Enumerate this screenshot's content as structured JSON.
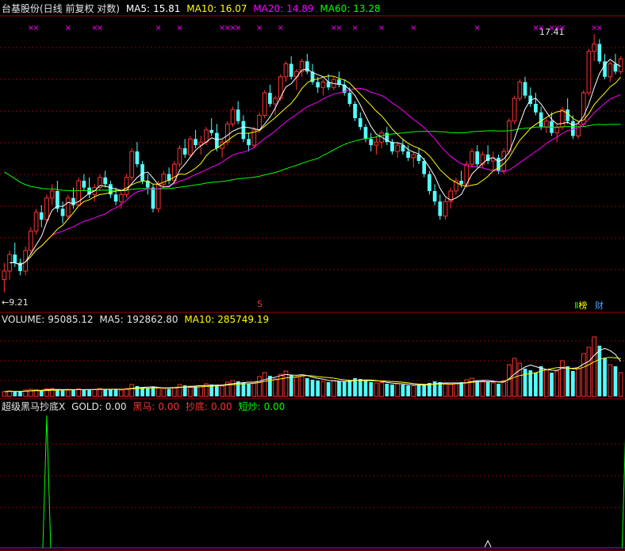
{
  "header": {
    "title": "台基股份(日线 前复权 对数)",
    "ma5_label": "MA5:",
    "ma5": "15.81",
    "ma10_label": "MA10:",
    "ma10": "16.07",
    "ma20_label": "MA20:",
    "ma20": "14.89",
    "ma60_label": "MA60:",
    "ma60": "13.28"
  },
  "volume_header": {
    "label": "VOLUME:",
    "value": "95085.12",
    "ma5_label": "MA5:",
    "ma5": "192862.80",
    "ma10_label": "MA10:",
    "ma10": "285749.19"
  },
  "indicator_header": {
    "name": "超级黑马抄底X",
    "gold_label": "GOLD:",
    "gold": "0.00",
    "heima_label": "黑马:",
    "heima": "0.00",
    "chaodi_label": "抄底:",
    "chaodi": "0.00",
    "duanchao_label": "短炒:",
    "duanchao": "0.00"
  },
  "annotations": {
    "high_label": "17.41",
    "low_label": "9.21",
    "marker_s": "S",
    "btn_bang": "榜",
    "btn_cai": "财",
    "btn_bang_prefix": "Ⅱ"
  },
  "colors": {
    "up": "#ff3232",
    "down": "#54ffff",
    "ma5": "#ffffff",
    "ma10": "#ffff00",
    "ma20": "#ff00ff",
    "ma60": "#00ff00",
    "grid": "#8b0000",
    "mark": "#ff00ff"
  },
  "chart_data": {
    "type": "candlestick",
    "price_range": [
      8.9,
      18.2
    ],
    "candles": [
      [
        9.6,
        10.0,
        9.3,
        9.8
      ],
      [
        9.8,
        10.3,
        9.6,
        10.2
      ],
      [
        10.2,
        10.5,
        9.9,
        10.0
      ],
      [
        10.0,
        10.1,
        9.7,
        9.8
      ],
      [
        9.8,
        10.4,
        9.7,
        10.3
      ],
      [
        10.3,
        10.9,
        10.2,
        10.8
      ],
      [
        10.8,
        11.4,
        10.7,
        11.3
      ],
      [
        11.3,
        11.5,
        10.9,
        11.1
      ],
      [
        11.1,
        11.8,
        11.0,
        11.7
      ],
      [
        11.7,
        12.1,
        11.5,
        11.9
      ],
      [
        11.9,
        12.2,
        11.3,
        11.4
      ],
      [
        11.4,
        11.6,
        11.0,
        11.2
      ],
      [
        11.2,
        11.8,
        11.1,
        11.7
      ],
      [
        11.7,
        12.0,
        11.4,
        11.5
      ],
      [
        11.5,
        12.3,
        11.5,
        12.2
      ],
      [
        12.2,
        12.4,
        11.9,
        12.0
      ],
      [
        12.0,
        12.3,
        11.7,
        11.8
      ],
      [
        11.8,
        12.1,
        11.6,
        12.0
      ],
      [
        12.0,
        12.4,
        11.9,
        12.3
      ],
      [
        12.3,
        12.5,
        12.0,
        12.1
      ],
      [
        12.1,
        12.2,
        11.7,
        11.8
      ],
      [
        11.8,
        12.0,
        11.5,
        11.6
      ],
      [
        11.6,
        11.9,
        11.4,
        11.8
      ],
      [
        11.8,
        12.4,
        11.7,
        12.3
      ],
      [
        12.3,
        13.2,
        12.2,
        13.1
      ],
      [
        13.1,
        13.4,
        12.6,
        12.7
      ],
      [
        12.7,
        12.8,
        12.1,
        12.2
      ],
      [
        12.2,
        12.4,
        11.8,
        12.0
      ],
      [
        12.0,
        12.1,
        11.3,
        11.4
      ],
      [
        11.4,
        12.2,
        11.3,
        12.1
      ],
      [
        12.1,
        12.5,
        12.0,
        12.4
      ],
      [
        12.4,
        12.6,
        12.1,
        12.2
      ],
      [
        12.2,
        12.8,
        12.1,
        12.7
      ],
      [
        12.7,
        13.3,
        12.6,
        13.2
      ],
      [
        13.2,
        13.5,
        12.9,
        13.0
      ],
      [
        13.0,
        13.6,
        12.9,
        13.5
      ],
      [
        13.5,
        13.8,
        13.2,
        13.3
      ],
      [
        13.3,
        13.6,
        13.0,
        13.4
      ],
      [
        13.4,
        13.9,
        13.3,
        13.8
      ],
      [
        13.8,
        14.2,
        13.6,
        13.7
      ],
      [
        13.7,
        14.0,
        13.1,
        13.2
      ],
      [
        13.2,
        13.5,
        12.9,
        13.4
      ],
      [
        13.4,
        14.1,
        13.3,
        14.0
      ],
      [
        14.0,
        14.6,
        13.9,
        14.5
      ],
      [
        14.5,
        14.8,
        14.0,
        14.1
      ],
      [
        14.1,
        14.3,
        13.4,
        13.5
      ],
      [
        13.5,
        13.7,
        13.1,
        13.3
      ],
      [
        13.3,
        13.9,
        13.2,
        13.8
      ],
      [
        13.8,
        14.4,
        13.7,
        14.3
      ],
      [
        14.3,
        15.2,
        14.2,
        15.1
      ],
      [
        15.1,
        15.4,
        14.6,
        14.7
      ],
      [
        14.7,
        15.0,
        14.3,
        14.9
      ],
      [
        14.9,
        15.8,
        14.8,
        15.7
      ],
      [
        15.7,
        16.3,
        15.5,
        16.2
      ],
      [
        16.2,
        16.5,
        15.6,
        15.7
      ],
      [
        15.7,
        16.0,
        15.2,
        15.9
      ],
      [
        15.9,
        16.4,
        15.7,
        16.3
      ],
      [
        16.3,
        16.6,
        15.8,
        15.9
      ],
      [
        15.9,
        16.2,
        15.4,
        15.5
      ],
      [
        15.5,
        15.7,
        15.1,
        15.3
      ],
      [
        15.3,
        15.6,
        15.0,
        15.5
      ],
      [
        15.5,
        15.8,
        15.2,
        15.3
      ],
      [
        15.3,
        15.7,
        15.2,
        15.6
      ],
      [
        15.6,
        15.9,
        15.3,
        15.4
      ],
      [
        15.4,
        15.6,
        15.0,
        15.1
      ],
      [
        15.1,
        15.3,
        14.6,
        14.7
      ],
      [
        14.7,
        14.8,
        14.1,
        14.2
      ],
      [
        14.2,
        14.4,
        13.8,
        13.9
      ],
      [
        13.9,
        14.0,
        13.4,
        13.5
      ],
      [
        13.5,
        13.7,
        13.1,
        13.3
      ],
      [
        13.3,
        13.6,
        13.0,
        13.4
      ],
      [
        13.4,
        13.8,
        13.2,
        13.7
      ],
      [
        13.7,
        13.9,
        13.3,
        13.4
      ],
      [
        13.4,
        13.5,
        13.0,
        13.1
      ],
      [
        13.1,
        13.4,
        12.9,
        13.3
      ],
      [
        13.3,
        13.5,
        13.0,
        13.1
      ],
      [
        13.1,
        13.3,
        12.8,
        12.9
      ],
      [
        12.9,
        13.1,
        12.6,
        13.0
      ],
      [
        13.0,
        13.2,
        12.7,
        12.8
      ],
      [
        12.8,
        12.9,
        12.3,
        12.4
      ],
      [
        12.4,
        12.5,
        11.8,
        11.9
      ],
      [
        11.9,
        12.1,
        11.5,
        11.6
      ],
      [
        11.6,
        11.8,
        11.1,
        11.2
      ],
      [
        11.2,
        11.7,
        11.1,
        11.6
      ],
      [
        11.6,
        12.0,
        11.4,
        11.9
      ],
      [
        11.9,
        12.3,
        11.8,
        12.2
      ],
      [
        12.2,
        12.5,
        12.0,
        12.1
      ],
      [
        12.1,
        12.8,
        12.0,
        12.7
      ],
      [
        12.7,
        13.2,
        12.6,
        13.1
      ],
      [
        13.1,
        13.3,
        12.6,
        12.7
      ],
      [
        12.7,
        13.1,
        12.6,
        13.0
      ],
      [
        13.0,
        13.3,
        12.7,
        12.8
      ],
      [
        12.8,
        13.1,
        12.5,
        12.9
      ],
      [
        12.9,
        13.0,
        12.4,
        12.5
      ],
      [
        12.5,
        13.2,
        12.4,
        13.1
      ],
      [
        13.1,
        14.2,
        13.0,
        14.1
      ],
      [
        14.1,
        15.0,
        14.0,
        14.9
      ],
      [
        14.9,
        15.6,
        14.8,
        15.5
      ],
      [
        15.5,
        15.7,
        14.9,
        15.0
      ],
      [
        15.0,
        15.3,
        14.6,
        14.7
      ],
      [
        14.7,
        15.1,
        14.3,
        14.4
      ],
      [
        14.4,
        14.6,
        13.8,
        13.9
      ],
      [
        13.9,
        14.2,
        13.7,
        14.1
      ],
      [
        14.1,
        14.4,
        13.6,
        13.7
      ],
      [
        13.7,
        14.0,
        13.4,
        13.9
      ],
      [
        13.9,
        14.6,
        13.8,
        14.5
      ],
      [
        14.5,
        14.9,
        14.0,
        14.1
      ],
      [
        14.1,
        14.3,
        13.5,
        13.6
      ],
      [
        13.6,
        14.1,
        13.5,
        14.0
      ],
      [
        14.0,
        15.2,
        13.9,
        15.1
      ],
      [
        15.1,
        16.8,
        15.0,
        16.7
      ],
      [
        16.7,
        17.41,
        16.3,
        17.0
      ],
      [
        17.0,
        17.2,
        16.2,
        16.3
      ],
      [
        16.3,
        16.6,
        15.6,
        15.7
      ],
      [
        15.7,
        16.3,
        15.5,
        16.2
      ],
      [
        16.2,
        16.6,
        15.8,
        15.9
      ],
      [
        15.9,
        16.5,
        15.8,
        16.4
      ]
    ],
    "volume_range": [
      0,
      900000
    ],
    "volume": [
      60000,
      70000,
      55000,
      65000,
      80000,
      90000,
      85000,
      70000,
      95000,
      100000,
      90000,
      75000,
      80000,
      85000,
      95000,
      90000,
      80000,
      85000,
      100000,
      95000,
      90000,
      85000,
      80000,
      100000,
      150000,
      130000,
      110000,
      100000,
      120000,
      110000,
      100000,
      95000,
      110000,
      150000,
      140000,
      130000,
      125000,
      135000,
      160000,
      150000,
      140000,
      130000,
      180000,
      200000,
      190000,
      170000,
      160000,
      180000,
      250000,
      300000,
      260000,
      220000,
      280000,
      320000,
      270000,
      240000,
      260000,
      230000,
      210000,
      200000,
      190000,
      180000,
      200000,
      190000,
      185000,
      200000,
      230000,
      220000,
      200000,
      180000,
      170000,
      175000,
      160000,
      150000,
      160000,
      150000,
      140000,
      135000,
      140000,
      150000,
      170000,
      190000,
      180000,
      160000,
      150000,
      170000,
      180000,
      210000,
      230000,
      200000,
      190000,
      180000,
      170000,
      160000,
      200000,
      400000,
      480000,
      420000,
      350000,
      330000,
      300000,
      380000,
      340000,
      300000,
      320000,
      450000,
      380000,
      320000,
      350000,
      540000,
      620000,
      750000,
      640000,
      480000,
      400000,
      380000,
      300000
    ],
    "indicator_spikes": [
      8,
      117,
      118,
      120
    ],
    "indicator_markers": [
      91,
      120
    ],
    "mark_positions": [
      5,
      6,
      12,
      17,
      18,
      29,
      33,
      41,
      42,
      43,
      44,
      48,
      52,
      62,
      63,
      66,
      71,
      77,
      89,
      100,
      101,
      103,
      104,
      105,
      111,
      112,
      118,
      121,
      122,
      124,
      126
    ]
  }
}
